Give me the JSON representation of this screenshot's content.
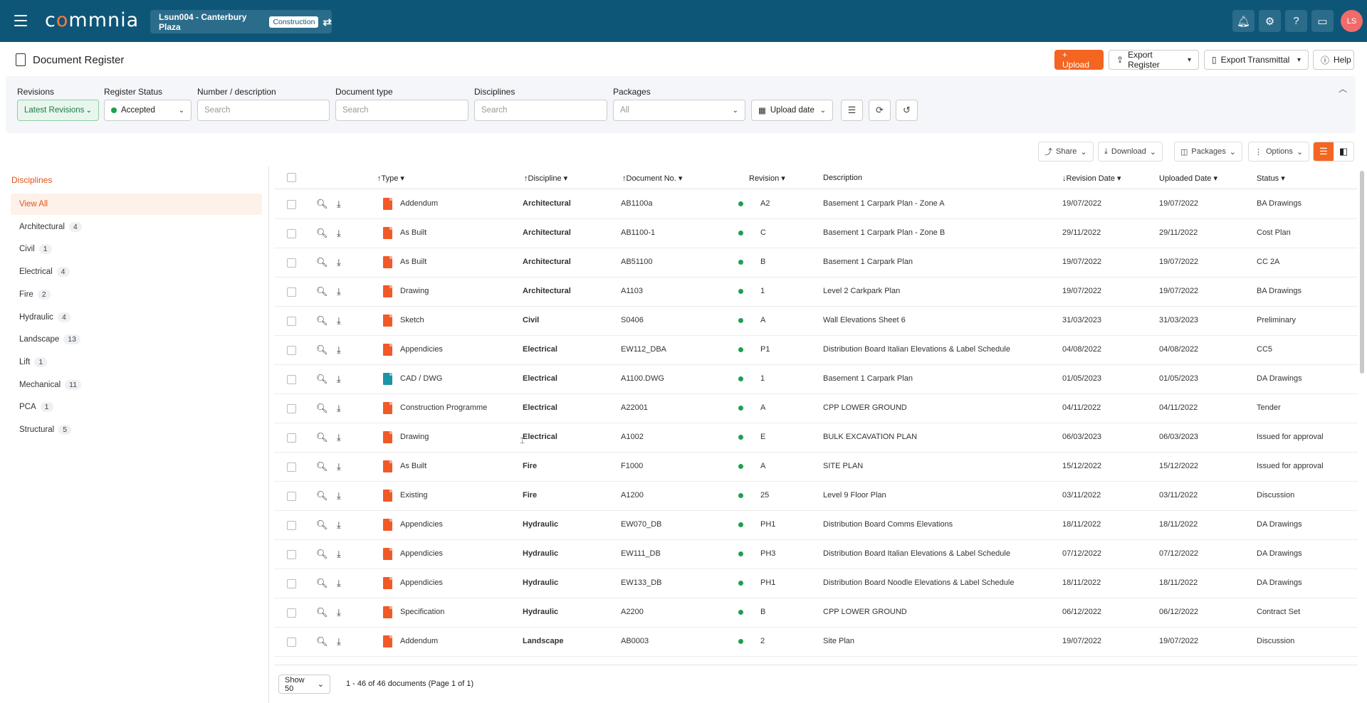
{
  "app": {
    "logo": "commnia",
    "project": "Lsun004 - Canterbury Plaza",
    "project_tag": "Construction",
    "avatar": "LS"
  },
  "page": {
    "title": "Document Register"
  },
  "actions": {
    "upload": "+ Upload",
    "export_register": "Export Register",
    "export_transmittal": "Export Transmittal",
    "help": "Help"
  },
  "filters": {
    "revisions": {
      "label": "Revisions",
      "value": "Latest Revisions"
    },
    "register_status": {
      "label": "Register Status",
      "value": "Accepted"
    },
    "number": {
      "label": "Number / description",
      "placeholder": "Search"
    },
    "doctype": {
      "label": "Document type",
      "placeholder": "Search"
    },
    "disciplines": {
      "label": "Disciplines",
      "placeholder": "Search"
    },
    "packages": {
      "label": "Packages",
      "value": "All"
    },
    "upload_date": "Upload date"
  },
  "toolbar": {
    "share": "Share",
    "download": "Download",
    "packages": "Packages",
    "options": "Options"
  },
  "sidebar": {
    "title": "Disciplines",
    "items": [
      {
        "label": "View All",
        "count": ""
      },
      {
        "label": "Architectural",
        "count": "4"
      },
      {
        "label": "Civil",
        "count": "1"
      },
      {
        "label": "Electrical",
        "count": "4"
      },
      {
        "label": "Fire",
        "count": "2"
      },
      {
        "label": "Hydraulic",
        "count": "4"
      },
      {
        "label": "Landscape",
        "count": "13"
      },
      {
        "label": "Lift",
        "count": "1"
      },
      {
        "label": "Mechanical",
        "count": "11"
      },
      {
        "label": "PCA",
        "count": "1"
      },
      {
        "label": "Structural",
        "count": "5"
      }
    ]
  },
  "table": {
    "headers": {
      "type": "Type",
      "discipline": "Discipline",
      "docno": "Document No.",
      "revision": "Revision",
      "description": "Description",
      "revdate": "Revision Date",
      "uploaded": "Uploaded Date",
      "status": "Status"
    },
    "rows": [
      {
        "type": "Addendum",
        "discipline": "Architectural",
        "docno": "AB1100a",
        "rev": "A2",
        "desc": "Basement 1 Carpark Plan - Zone A",
        "revdate": "19/07/2022",
        "uploaded": "19/07/2022",
        "status": "BA Drawings",
        "icon": "pdf"
      },
      {
        "type": "As Built",
        "discipline": "Architectural",
        "docno": "AB1100-1",
        "rev": "C",
        "desc": "Basement 1 Carpark Plan - Zone B",
        "revdate": "29/11/2022",
        "uploaded": "29/11/2022",
        "status": "Cost Plan",
        "icon": "pdf"
      },
      {
        "type": "As Built",
        "discipline": "Architectural",
        "docno": "AB51100",
        "rev": "B",
        "desc": "Basement 1 Carpark Plan",
        "revdate": "19/07/2022",
        "uploaded": "19/07/2022",
        "status": "CC 2A",
        "icon": "pdf"
      },
      {
        "type": "Drawing",
        "discipline": "Architectural",
        "docno": "A1103",
        "rev": "1",
        "desc": "Level 2 Carkpark Plan",
        "revdate": "19/07/2022",
        "uploaded": "19/07/2022",
        "status": "BA Drawings",
        "icon": "pdf"
      },
      {
        "type": "Sketch",
        "discipline": "Civil",
        "docno": "S0406",
        "rev": "A",
        "desc": "Wall Elevations Sheet 6",
        "revdate": "31/03/2023",
        "uploaded": "31/03/2023",
        "status": "Preliminary",
        "icon": "pdf"
      },
      {
        "type": "Appendicies",
        "discipline": "Electrical",
        "docno": "EW112_DBA",
        "rev": "P1",
        "desc": "Distribution Board Italian Elevations & Label Schedule",
        "revdate": "04/08/2022",
        "uploaded": "04/08/2022",
        "status": "CC5",
        "icon": "pdf"
      },
      {
        "type": "CAD / DWG",
        "discipline": "Electrical",
        "docno": "A1100.DWG",
        "rev": "1",
        "desc": "Basement 1 Carpark Plan",
        "revdate": "01/05/2023",
        "uploaded": "01/05/2023",
        "status": "DA Drawings",
        "icon": "dwg"
      },
      {
        "type": "Construction Programme",
        "discipline": "Electrical",
        "docno": "A22001",
        "rev": "A",
        "desc": "CPP LOWER GROUND",
        "revdate": "04/11/2022",
        "uploaded": "04/11/2022",
        "status": "Tender",
        "icon": "pdf"
      },
      {
        "type": "Drawing",
        "discipline": "Electrical",
        "docno": "A1002",
        "rev": "E",
        "desc": "BULK EXCAVATION PLAN",
        "revdate": "06/03/2023",
        "uploaded": "06/03/2023",
        "status": "Issued for approval",
        "icon": "pdf"
      },
      {
        "type": "As Built",
        "discipline": "Fire",
        "docno": "F1000",
        "rev": "A",
        "desc": "SITE PLAN",
        "revdate": "15/12/2022",
        "uploaded": "15/12/2022",
        "status": "Issued for approval",
        "icon": "pdf"
      },
      {
        "type": "Existing",
        "discipline": "Fire",
        "docno": "A1200",
        "rev": "25",
        "desc": "Level 9 Floor Plan",
        "revdate": "03/11/2022",
        "uploaded": "03/11/2022",
        "status": "Discussion",
        "icon": "pdf"
      },
      {
        "type": "Appendicies",
        "discipline": "Hydraulic",
        "docno": "EW070_DB",
        "rev": "PH1",
        "desc": "Distribution Board Comms Elevations",
        "revdate": "18/11/2022",
        "uploaded": "18/11/2022",
        "status": "DA Drawings",
        "icon": "pdf"
      },
      {
        "type": "Appendicies",
        "discipline": "Hydraulic",
        "docno": "EW111_DB",
        "rev": "PH3",
        "desc": "Distribution Board Italian Elevations & Label Schedule",
        "revdate": "07/12/2022",
        "uploaded": "07/12/2022",
        "status": "DA Drawings",
        "icon": "pdf"
      },
      {
        "type": "Appendicies",
        "discipline": "Hydraulic",
        "docno": "EW133_DB",
        "rev": "PH1",
        "desc": "Distribution Board Noodle Elevations & Label Schedule",
        "revdate": "18/11/2022",
        "uploaded": "18/11/2022",
        "status": "DA Drawings",
        "icon": "pdf"
      },
      {
        "type": "Specification",
        "discipline": "Hydraulic",
        "docno": "A2200",
        "rev": "B",
        "desc": "CPP LOWER GROUND",
        "revdate": "06/12/2022",
        "uploaded": "06/12/2022",
        "status": "Contract Set",
        "icon": "pdf"
      },
      {
        "type": "Addendum",
        "discipline": "Landscape",
        "docno": "AB0003",
        "rev": "2",
        "desc": "Site Plan",
        "revdate": "19/07/2022",
        "uploaded": "19/07/2022",
        "status": "Discussion",
        "icon": "pdf"
      }
    ]
  },
  "footer": {
    "show": "Show 50",
    "pagination": "1 - 46 of 46 documents (Page 1 of 1)"
  }
}
